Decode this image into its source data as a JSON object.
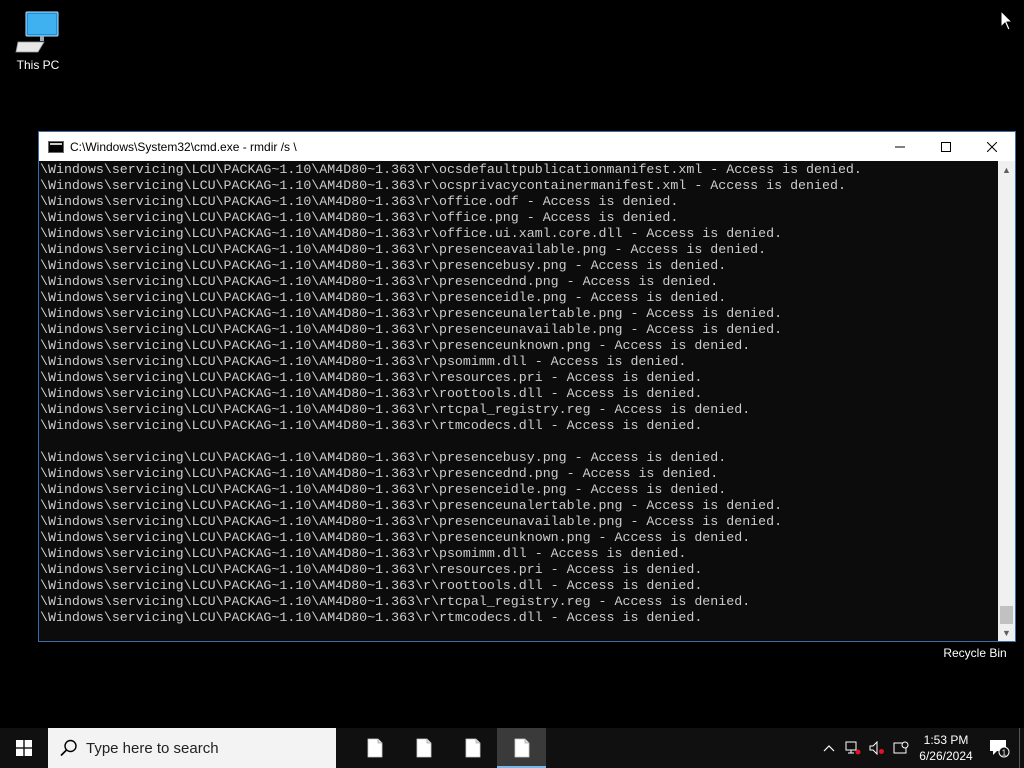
{
  "desktop": {
    "this_pc_label": "This PC",
    "recycle_bin_label": "Recycle Bin"
  },
  "window": {
    "title": "C:\\Windows\\System32\\cmd.exe - rmdir  /s \\",
    "minimize_icon": "minimize-icon",
    "maximize_icon": "maximize-icon",
    "close_icon": "close-icon"
  },
  "terminal": {
    "lines": [
      "\\Windows\\servicing\\LCU\\PACKAG~1.10\\AM4D80~1.363\\r\\ocsdefaultpublicationmanifest.xml - Access is denied.",
      "\\Windows\\servicing\\LCU\\PACKAG~1.10\\AM4D80~1.363\\r\\ocsprivacycontainermanifest.xml - Access is denied.",
      "\\Windows\\servicing\\LCU\\PACKAG~1.10\\AM4D80~1.363\\r\\office.odf - Access is denied.",
      "\\Windows\\servicing\\LCU\\PACKAG~1.10\\AM4D80~1.363\\r\\office.png - Access is denied.",
      "\\Windows\\servicing\\LCU\\PACKAG~1.10\\AM4D80~1.363\\r\\office.ui.xaml.core.dll - Access is denied.",
      "\\Windows\\servicing\\LCU\\PACKAG~1.10\\AM4D80~1.363\\r\\presenceavailable.png - Access is denied.",
      "\\Windows\\servicing\\LCU\\PACKAG~1.10\\AM4D80~1.363\\r\\presencebusy.png - Access is denied.",
      "\\Windows\\servicing\\LCU\\PACKAG~1.10\\AM4D80~1.363\\r\\presencednd.png - Access is denied.",
      "\\Windows\\servicing\\LCU\\PACKAG~1.10\\AM4D80~1.363\\r\\presenceidle.png - Access is denied.",
      "\\Windows\\servicing\\LCU\\PACKAG~1.10\\AM4D80~1.363\\r\\presenceunalertable.png - Access is denied.",
      "\\Windows\\servicing\\LCU\\PACKAG~1.10\\AM4D80~1.363\\r\\presenceunavailable.png - Access is denied.",
      "\\Windows\\servicing\\LCU\\PACKAG~1.10\\AM4D80~1.363\\r\\presenceunknown.png - Access is denied.",
      "\\Windows\\servicing\\LCU\\PACKAG~1.10\\AM4D80~1.363\\r\\psomimm.dll - Access is denied.",
      "\\Windows\\servicing\\LCU\\PACKAG~1.10\\AM4D80~1.363\\r\\resources.pri - Access is denied.",
      "\\Windows\\servicing\\LCU\\PACKAG~1.10\\AM4D80~1.363\\r\\roottools.dll - Access is denied.",
      "\\Windows\\servicing\\LCU\\PACKAG~1.10\\AM4D80~1.363\\r\\rtcpal_registry.reg - Access is denied.",
      "\\Windows\\servicing\\LCU\\PACKAG~1.10\\AM4D80~1.363\\r\\rtmcodecs.dll - Access is denied.",
      "",
      "\\Windows\\servicing\\LCU\\PACKAG~1.10\\AM4D80~1.363\\r\\presencebusy.png - Access is denied.",
      "\\Windows\\servicing\\LCU\\PACKAG~1.10\\AM4D80~1.363\\r\\presencednd.png - Access is denied.",
      "\\Windows\\servicing\\LCU\\PACKAG~1.10\\AM4D80~1.363\\r\\presenceidle.png - Access is denied.",
      "\\Windows\\servicing\\LCU\\PACKAG~1.10\\AM4D80~1.363\\r\\presenceunalertable.png - Access is denied.",
      "\\Windows\\servicing\\LCU\\PACKAG~1.10\\AM4D80~1.363\\r\\presenceunavailable.png - Access is denied.",
      "\\Windows\\servicing\\LCU\\PACKAG~1.10\\AM4D80~1.363\\r\\presenceunknown.png - Access is denied.",
      "\\Windows\\servicing\\LCU\\PACKAG~1.10\\AM4D80~1.363\\r\\psomimm.dll - Access is denied.",
      "\\Windows\\servicing\\LCU\\PACKAG~1.10\\AM4D80~1.363\\r\\resources.pri - Access is denied.",
      "\\Windows\\servicing\\LCU\\PACKAG~1.10\\AM4D80~1.363\\r\\roottools.dll - Access is denied.",
      "\\Windows\\servicing\\LCU\\PACKAG~1.10\\AM4D80~1.363\\r\\rtcpal_registry.reg - Access is denied.",
      "\\Windows\\servicing\\LCU\\PACKAG~1.10\\AM4D80~1.363\\r\\rtmcodecs.dll - Access is denied."
    ]
  },
  "taskbar": {
    "search_placeholder": "Type here to search",
    "apps": [
      {
        "icon": "document-icon",
        "active": false
      },
      {
        "icon": "document-icon",
        "active": false
      },
      {
        "icon": "document-icon",
        "active": false
      },
      {
        "icon": "document-icon",
        "active": true
      }
    ],
    "clock_time": "1:53 PM",
    "clock_date": "6/26/2024",
    "notification_count": "1"
  },
  "colors": {
    "terminal_bg": "#0c0c0c",
    "terminal_fg": "#cccccc",
    "taskbar_bg": "#101010",
    "active_indicator": "#76b9ed"
  }
}
